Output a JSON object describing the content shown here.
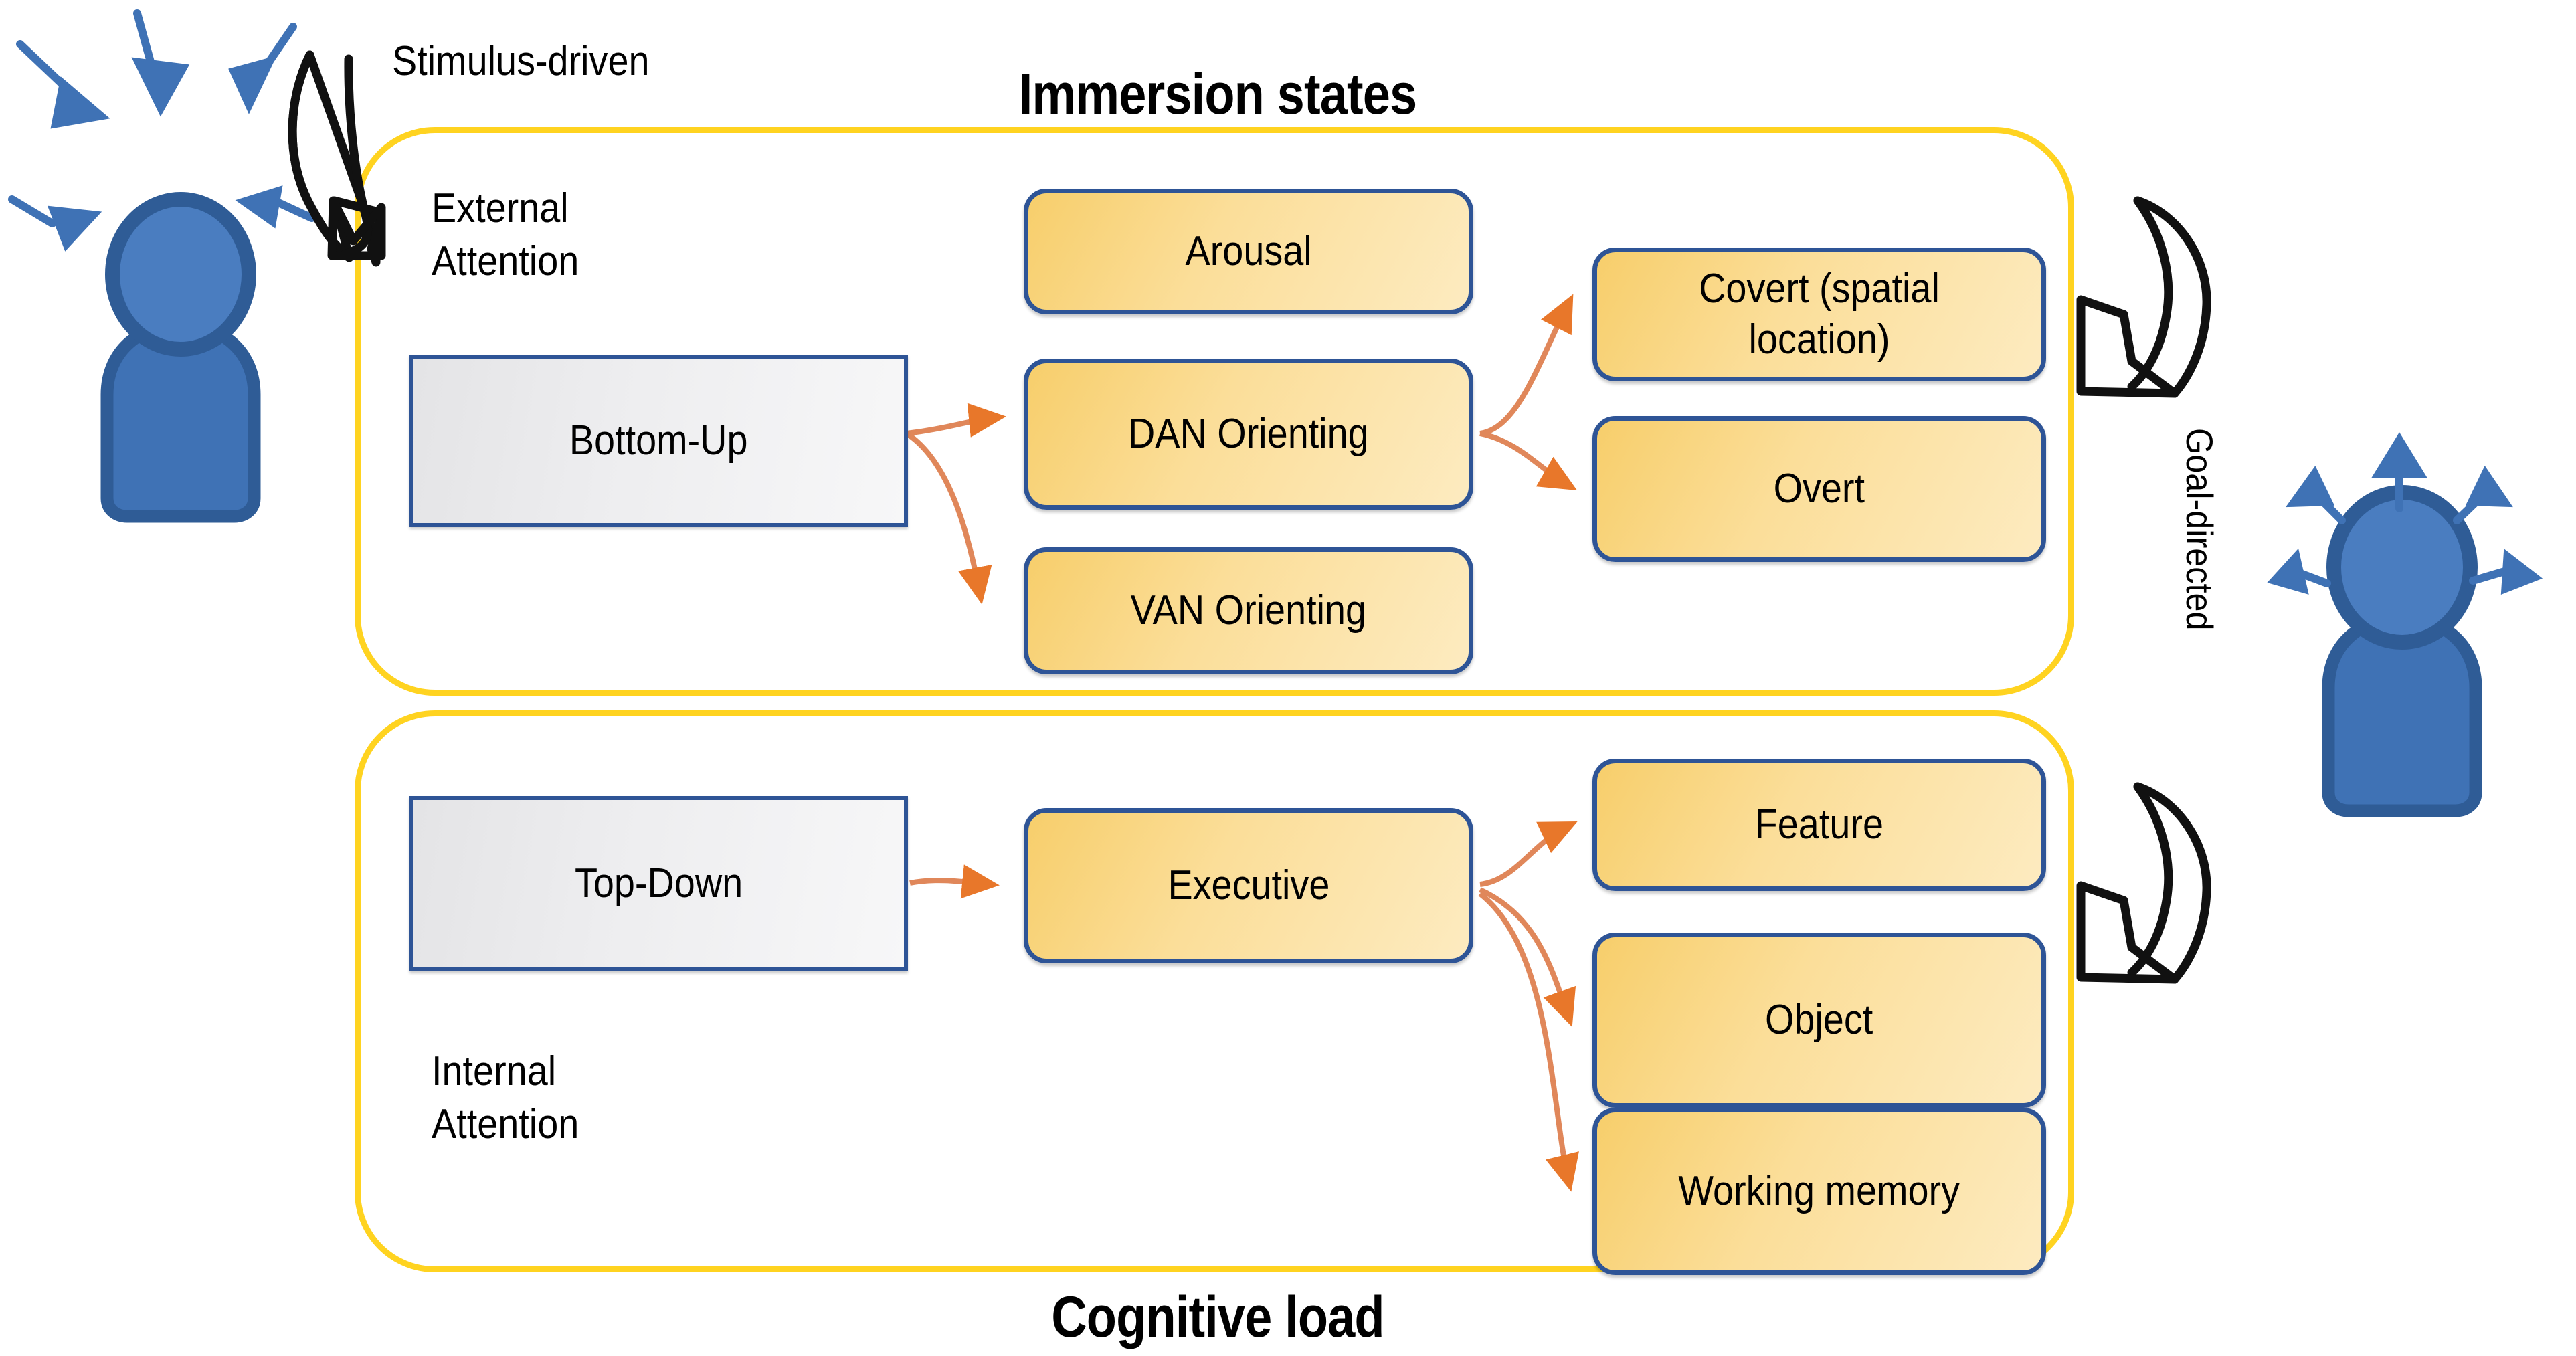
{
  "diagram": {
    "top_title": "Immersion states",
    "bottom_title": "Cognitive load",
    "left_annotation": "Stimulus-driven",
    "right_annotation": "Goal-directed"
  },
  "upper_section": {
    "axis_label": "External\nAttention",
    "source_node": {
      "label": "Bottom-Up",
      "style": "gray"
    },
    "mid_nodes": [
      {
        "label": "Arousal",
        "style": "yellow"
      },
      {
        "label": "DAN Orienting",
        "style": "yellow"
      },
      {
        "label": "VAN Orienting",
        "style": "yellow"
      }
    ],
    "end_nodes": [
      {
        "label": "Covert (spatial location)",
        "style": "yellow"
      },
      {
        "label": "Overt",
        "style": "yellow"
      }
    ]
  },
  "lower_section": {
    "axis_label": "Internal\nAttention",
    "source_node": {
      "label": "Top-Down",
      "style": "gray"
    },
    "mid_nodes": [
      {
        "label": "Executive",
        "style": "yellow"
      }
    ],
    "end_nodes": [
      {
        "label": "Feature",
        "style": "yellow"
      },
      {
        "label": "Object",
        "style": "yellow"
      },
      {
        "label": "Working memory",
        "style": "yellow"
      }
    ]
  },
  "figures": {
    "left_person": "person-with-inward-arrows",
    "right_person": "person-with-outward-arrows"
  },
  "colors": {
    "group_border": "#FFD320",
    "node_border": "#2E5496",
    "node_fill_start": "#F7CE6B",
    "node_fill_end": "#FDEBC0",
    "gray_fill_start": "#E4E4E6",
    "gray_fill_end": "#F7F7F8",
    "connector": "#E8833A",
    "person": "#3F72B5",
    "person_dark": "#2F5C96",
    "text": "#000000"
  }
}
